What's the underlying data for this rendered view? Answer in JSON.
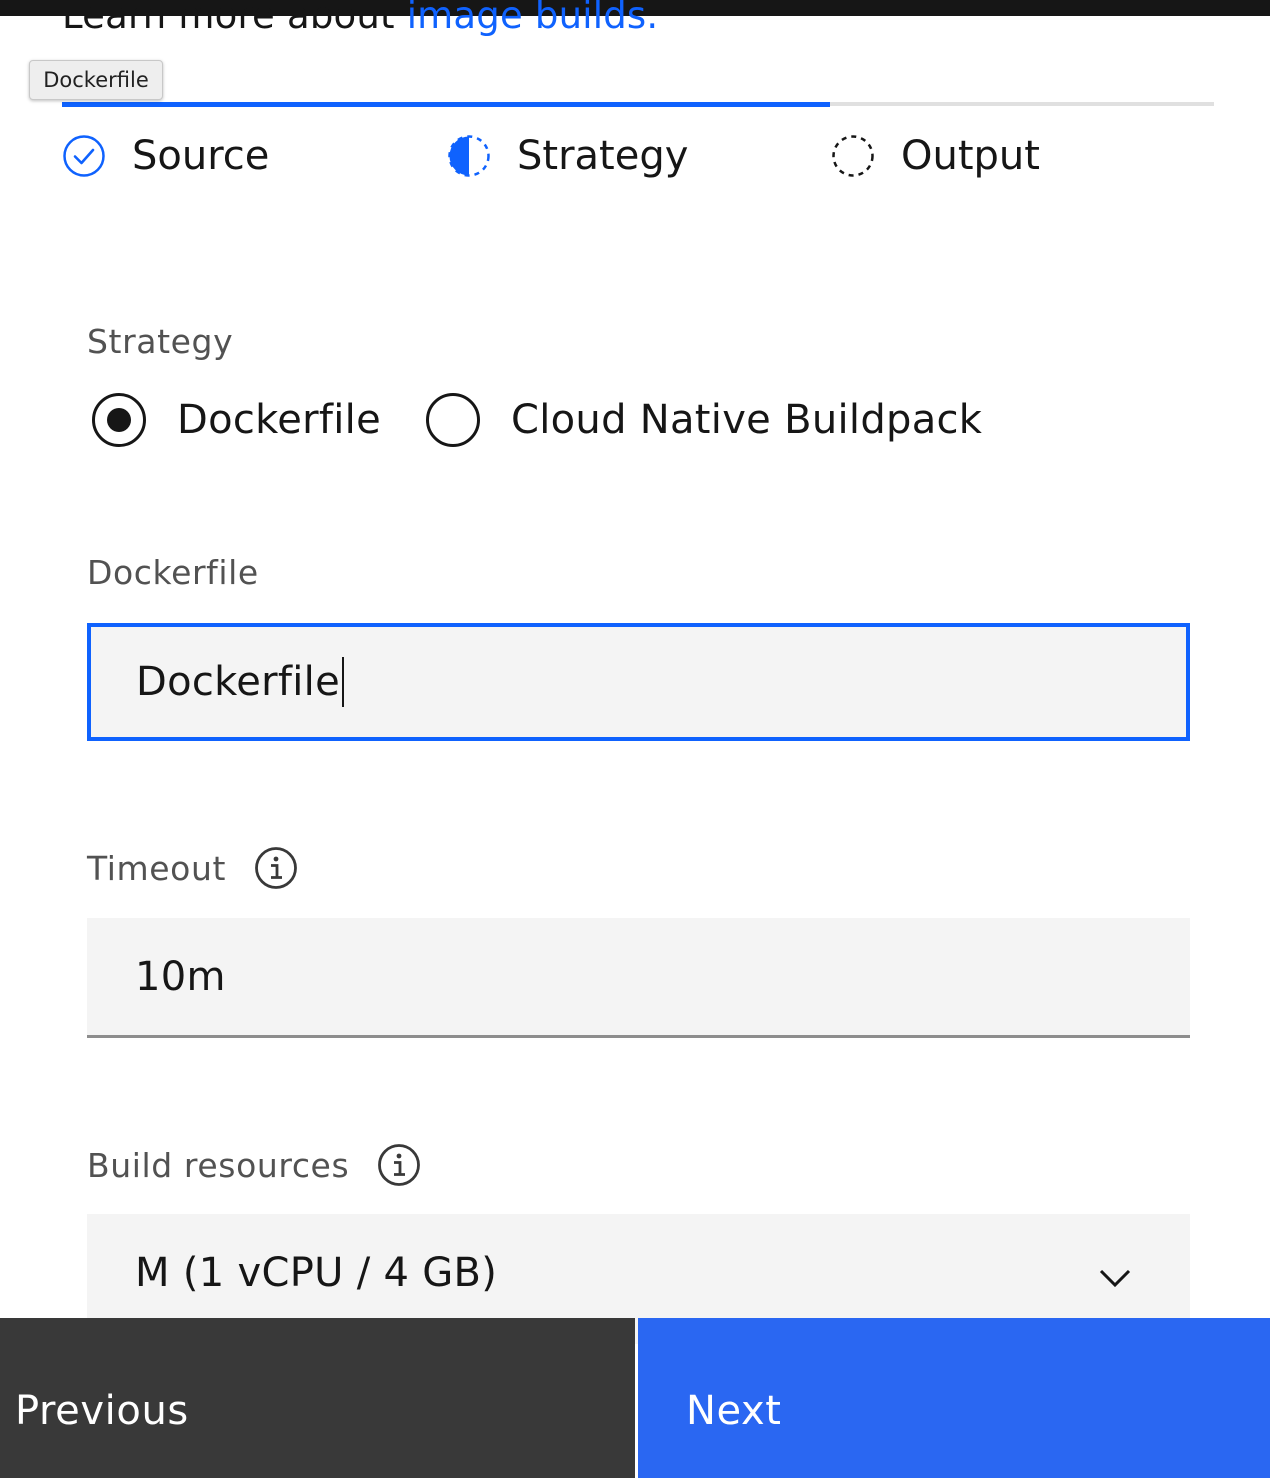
{
  "intro": {
    "text": "Learn more about ",
    "link_text": "image builds."
  },
  "tooltip": {
    "text": "Dockerfile"
  },
  "progress": {
    "completed_fraction": 0.667
  },
  "steps": [
    {
      "label": "Source",
      "status": "complete",
      "icon": "checkmark-circle-icon"
    },
    {
      "label": "Strategy",
      "status": "current",
      "icon": "half-circle-icon"
    },
    {
      "label": "Output",
      "status": "incomplete",
      "icon": "dashed-circle-icon"
    }
  ],
  "strategy": {
    "label": "Strategy",
    "options": [
      {
        "label": "Dockerfile",
        "selected": true
      },
      {
        "label": "Cloud Native Buildpack",
        "selected": false
      }
    ]
  },
  "dockerfile": {
    "label": "Dockerfile",
    "value": "Dockerfile"
  },
  "timeout": {
    "label": "Timeout",
    "value": "10m"
  },
  "build_resources": {
    "label": "Build resources",
    "selected": "M (1 vCPU / 4 GB)"
  },
  "footer": {
    "previous_label": "Previous",
    "next_label": "Next"
  },
  "colors": {
    "accent": "#0f62fe",
    "next_button": "#2a67f2",
    "previous_button": "#393939",
    "field_background": "#f4f4f4"
  }
}
